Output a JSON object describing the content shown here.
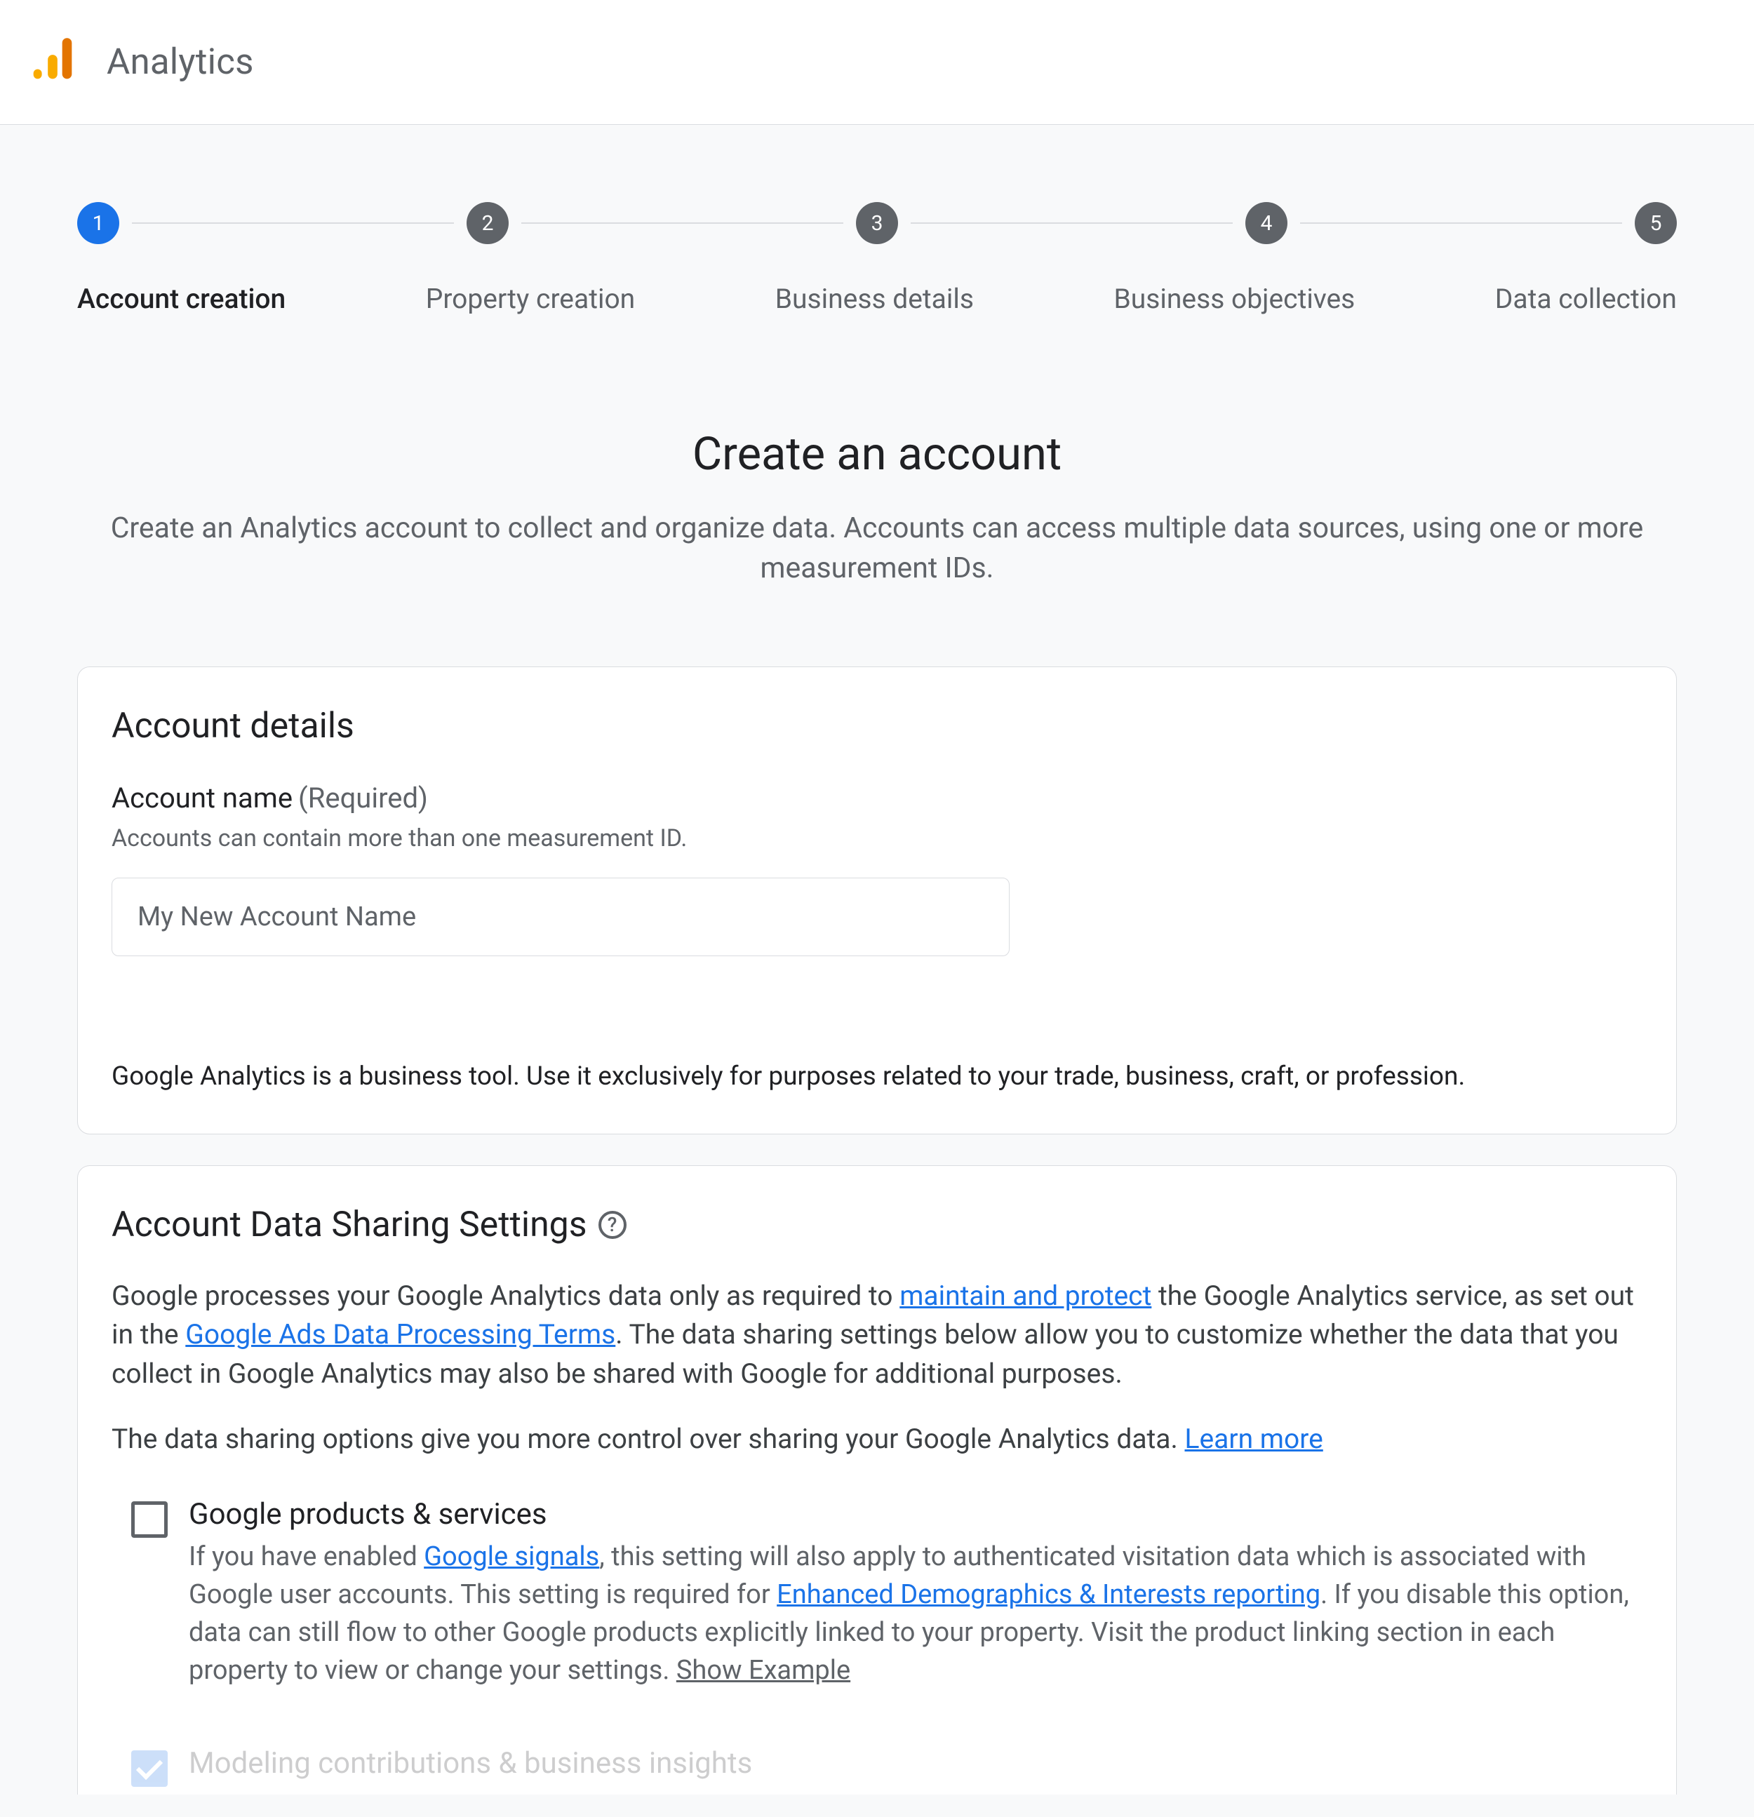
{
  "header": {
    "brand": "Analytics"
  },
  "stepper": {
    "steps": [
      {
        "num": "1",
        "label": "Account creation",
        "active": true
      },
      {
        "num": "2",
        "label": "Property creation",
        "active": false
      },
      {
        "num": "3",
        "label": "Business details",
        "active": false
      },
      {
        "num": "4",
        "label": "Business objectives",
        "active": false
      },
      {
        "num": "5",
        "label": "Data collection",
        "active": false
      }
    ]
  },
  "intro": {
    "title": "Create an account",
    "subtitle": "Create an Analytics account to collect and organize data. Accounts can access multiple data sources, using one or more measurement IDs."
  },
  "account_details": {
    "heading": "Account details",
    "name_label": "Account name",
    "name_required": "(Required)",
    "name_help": "Accounts can contain more than one measurement ID.",
    "name_placeholder": "My New Account Name",
    "disclaimer": "Google Analytics is a business tool. Use it exclusively for purposes related to your trade, business, craft, or profession."
  },
  "sharing": {
    "heading": "Account Data Sharing Settings",
    "p1a": "Google processes your Google Analytics data only as required to ",
    "p1_link1": "maintain and protect",
    "p1b": " the Google Analytics service, as set out in the ",
    "p1_link2": "Google Ads Data Processing Terms",
    "p1c": ". The data sharing settings below allow you to customize whether the data that you collect in Google Analytics may also be shared with Google for additional purposes.",
    "p2a": "The data sharing options give you more control over sharing your Google Analytics data. ",
    "p2_link": "Learn more",
    "opt1": {
      "title": "Google products & services",
      "d1": "If you have enabled ",
      "l1": "Google signals",
      "d2": ", this setting will also apply to authenticated visitation data which is associated with Google user accounts. This setting is required for ",
      "l2": "Enhanced Demographics & Interests reporting",
      "d3": ". If you disable this option, data can still flow to other Google products explicitly linked to your property. Visit the product linking section in each property to view or change your settings. ",
      "l3": "Show Example"
    },
    "opt2": {
      "title": "Modeling contributions & business insights"
    }
  }
}
